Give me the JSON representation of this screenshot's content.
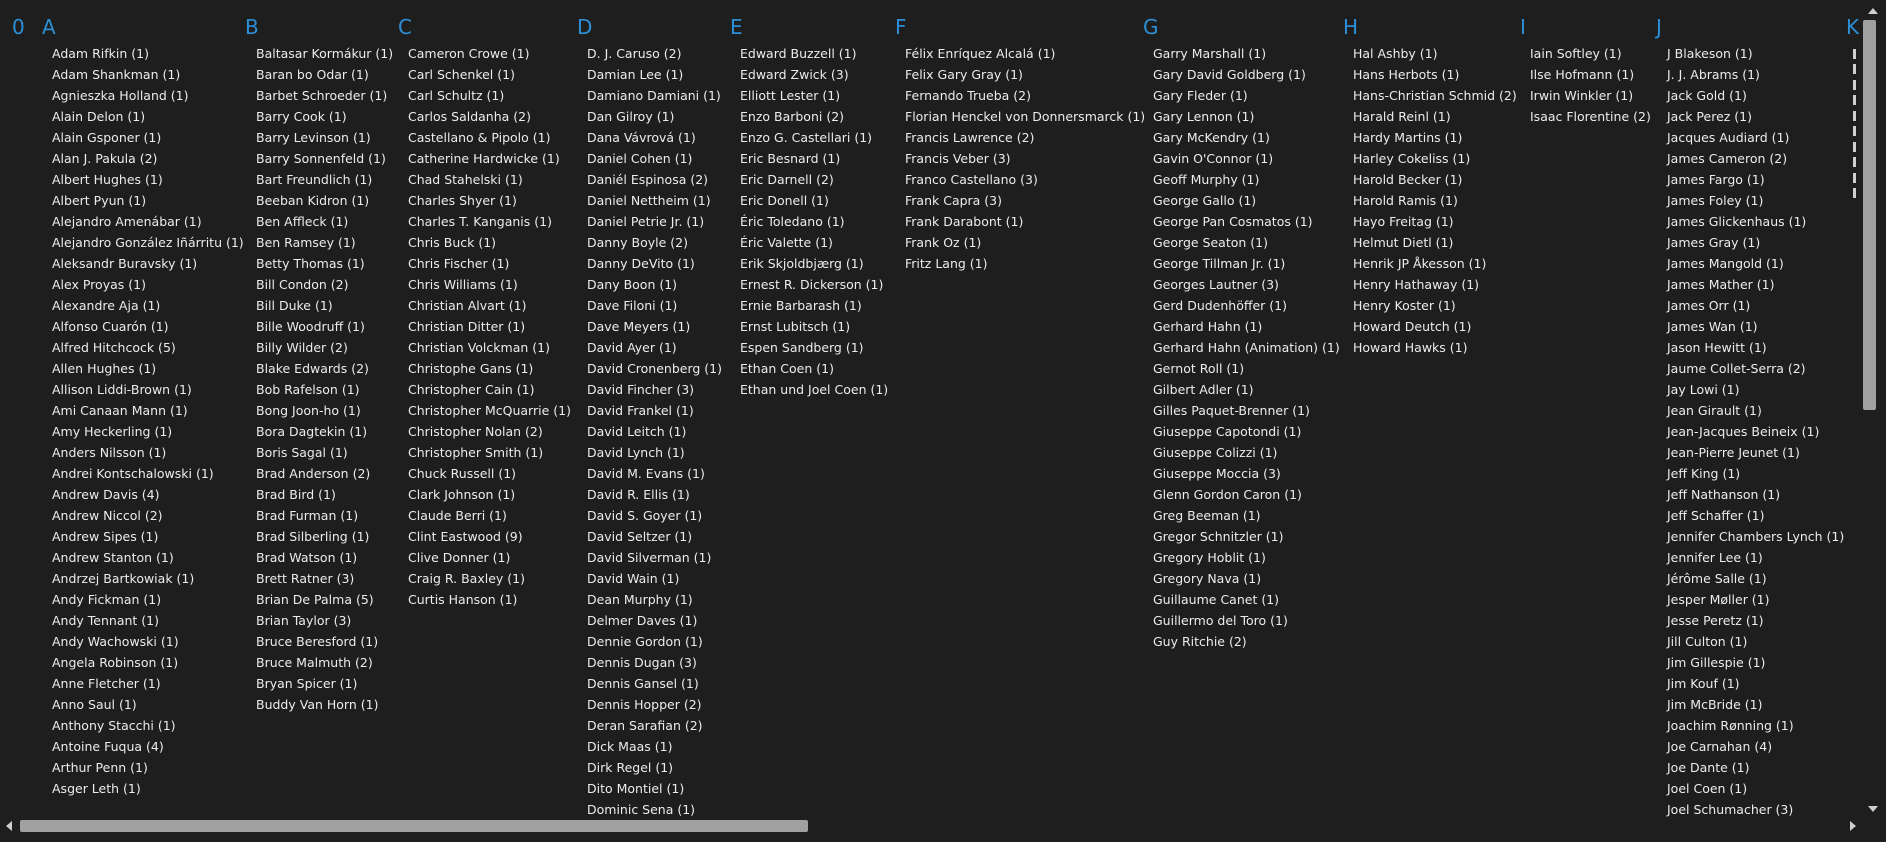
{
  "headers": {
    "h0": "0",
    "hA": "A",
    "hB": "B",
    "hC": "C",
    "hD": "D",
    "hE": "E",
    "hF": "F",
    "hG": "G",
    "hH": "H",
    "hI": "I",
    "hJ": "J",
    "hK": "K"
  },
  "theme": {
    "background": "#1e1e1e",
    "header_color": "#2d8fd5",
    "text_color": "#ececec",
    "scrollbar": "#a0a0a0"
  },
  "columns": {
    "A": [
      "Adam Rifkin (1)",
      "Adam Shankman (1)",
      "Agnieszka Holland (1)",
      "Alain Delon (1)",
      "Alain Gsponer (1)",
      "Alan J. Pakula (2)",
      "Albert Hughes (1)",
      "Albert Pyun (1)",
      "Alejandro Amenábar (1)",
      "Alejandro González Iñárritu (1)",
      "Aleksandr Buravsky (1)",
      "Alex Proyas (1)",
      "Alexandre Aja (1)",
      "Alfonso Cuarón (1)",
      "Alfred Hitchcock (5)",
      "Allen Hughes (1)",
      "Allison Liddi-Brown (1)",
      "Ami Canaan Mann (1)",
      "Amy Heckerling (1)",
      "Anders Nilsson (1)",
      "Andrei Kontschalowski (1)",
      "Andrew Davis (4)",
      "Andrew Niccol (2)",
      "Andrew Sipes (1)",
      "Andrew Stanton (1)",
      "Andrzej Bartkowiak (1)",
      "Andy Fickman (1)",
      "Andy Tennant (1)",
      "Andy Wachowski (1)",
      "Angela Robinson (1)",
      "Anne Fletcher (1)",
      "Anno Saul (1)",
      "Anthony Stacchi (1)",
      "Antoine Fuqua (4)",
      "Arthur Penn (1)",
      "Asger Leth (1)"
    ],
    "B": [
      "Baltasar Kormákur (1)",
      "Baran bo Odar (1)",
      "Barbet Schroeder (1)",
      "Barry Cook (1)",
      "Barry Levinson (1)",
      "Barry Sonnenfeld (1)",
      "Bart Freundlich (1)",
      "Beeban Kidron (1)",
      "Ben Affleck (1)",
      "Ben Ramsey (1)",
      "Betty Thomas (1)",
      "Bill Condon (2)",
      "Bill Duke (1)",
      "Bille Woodruff (1)",
      "Billy Wilder (2)",
      "Blake Edwards (2)",
      "Bob Rafelson (1)",
      "Bong Joon-ho (1)",
      "Bora Dagtekin (1)",
      "Boris Sagal (1)",
      "Brad Anderson (2)",
      "Brad Bird (1)",
      "Brad Furman (1)",
      "Brad Silberling (1)",
      "Brad Watson (1)",
      "Brett Ratner (3)",
      "Brian De Palma (5)",
      "Brian Taylor (3)",
      "Bruce Beresford (1)",
      "Bruce Malmuth (2)",
      "Bryan Spicer (1)",
      "Buddy Van Horn (1)"
    ],
    "C": [
      "Cameron Crowe (1)",
      "Carl Schenkel (1)",
      "Carl Schultz (1)",
      "Carlos Saldanha (2)",
      "Castellano & Pipolo (1)",
      "Catherine Hardwicke (1)",
      "Chad Stahelski (1)",
      "Charles Shyer (1)",
      "Charles T. Kanganis (1)",
      "Chris Buck (1)",
      "Chris Fischer (1)",
      "Chris Williams (1)",
      "Christian Alvart (1)",
      "Christian Ditter (1)",
      "Christian Volckman (1)",
      "Christophe Gans (1)",
      "Christopher Cain (1)",
      "Christopher McQuarrie (1)",
      "Christopher Nolan (2)",
      "Christopher Smith (1)",
      "Chuck Russell (1)",
      "Clark Johnson (1)",
      "Claude Berri (1)",
      "Clint Eastwood (9)",
      "Clive Donner (1)",
      "Craig R. Baxley (1)",
      "Curtis Hanson (1)"
    ],
    "D": [
      "D. J. Caruso (2)",
      "Damian Lee (1)",
      "Damiano Damiani (1)",
      "Dan Gilroy (1)",
      "Dana Vávrová (1)",
      "Daniel Cohen (1)",
      "Daniél Espinosa (2)",
      "Daniel Nettheim (1)",
      "Daniel Petrie Jr. (1)",
      "Danny Boyle (2)",
      "Danny DeVito (1)",
      "Dany Boon (1)",
      "Dave Filoni (1)",
      "Dave Meyers (1)",
      "David Ayer (1)",
      "David Cronenberg (1)",
      "David Fincher (3)",
      "David Frankel (1)",
      "David Leitch (1)",
      "David Lynch (1)",
      "David M. Evans (1)",
      "David R. Ellis (1)",
      "David S. Goyer (1)",
      "David Seltzer (1)",
      "David Silverman (1)",
      "David Wain (1)",
      "Dean Murphy (1)",
      "Delmer Daves (1)",
      "Dennie Gordon (1)",
      "Dennis Dugan (3)",
      "Dennis Gansel (1)",
      "Dennis Hopper (2)",
      "Deran Sarafian (2)",
      "Dick Maas (1)",
      "Dirk Regel (1)",
      "Dito Montiel (1)",
      "Dominic Sena (1)"
    ],
    "E": [
      "Edward Buzzell (1)",
      "Edward Zwick (3)",
      "Elliott Lester (1)",
      "Enzo Barboni (2)",
      "Enzo G. Castellari (1)",
      "Eric Besnard (1)",
      "Eric Darnell (2)",
      "Eric Donell (1)",
      "Éric Toledano (1)",
      "Éric Valette (1)",
      "Erik Skjoldbjærg (1)",
      "Ernest R. Dickerson (1)",
      "Ernie Barbarash (1)",
      "Ernst Lubitsch (1)",
      "Espen Sandberg (1)",
      "Ethan Coen (1)",
      "Ethan und Joel Coen (1)"
    ],
    "F": [
      "Félix Enríquez Alcalá (1)",
      "Felix Gary Gray (1)",
      "Fernando Trueba (2)",
      "Florian Henckel von Donnersmarck (1)",
      "Francis Lawrence (2)",
      "Francis Veber (3)",
      "Franco Castellano (3)",
      "Frank Capra (3)",
      "Frank Darabont (1)",
      "Frank Oz (1)",
      "Fritz Lang (1)"
    ],
    "G": [
      "Garry Marshall (1)",
      "Gary David Goldberg (1)",
      "Gary Fleder (1)",
      "Gary Lennon (1)",
      "Gary McKendry (1)",
      "Gavin O'Connor (1)",
      "Geoff Murphy (1)",
      "George Gallo (1)",
      "George Pan Cosmatos (1)",
      "George Seaton (1)",
      "George Tillman Jr. (1)",
      "Georges Lautner (3)",
      "Gerd Dudenhöffer (1)",
      "Gerhard Hahn (1)",
      "Gerhard Hahn (Animation) (1)",
      "Gernot Roll (1)",
      "Gilbert Adler (1)",
      "Gilles Paquet-Brenner (1)",
      "Giuseppe Capotondi (1)",
      "Giuseppe Colizzi (1)",
      "Giuseppe Moccia (3)",
      "Glenn Gordon Caron (1)",
      "Greg Beeman (1)",
      "Gregor Schnitzler (1)",
      "Gregory Hoblit (1)",
      "Gregory Nava (1)",
      "Guillaume Canet (1)",
      "Guillermo del Toro (1)",
      "Guy Ritchie (2)"
    ],
    "H": [
      "Hal Ashby (1)",
      "Hans Herbots (1)",
      "Hans-Christian Schmid (2)",
      "Harald Reinl (1)",
      "Hardy Martins (1)",
      "Harley Cokeliss (1)",
      "Harold Becker (1)",
      "Harold Ramis (1)",
      "Hayo Freitag (1)",
      "Helmut Dietl (1)",
      "Henrik JP Åkesson (1)",
      "Henry Hathaway (1)",
      "Henry Koster (1)",
      "Howard Deutch (1)",
      "Howard Hawks (1)"
    ],
    "I": [
      "Iain Softley (1)",
      "Ilse Hofmann (1)",
      "Irwin Winkler (1)",
      "Isaac Florentine (2)"
    ],
    "J": [
      "J Blakeson (1)",
      "J. J. Abrams (1)",
      "Jack Gold (1)",
      "Jack Perez (1)",
      "Jacques Audiard (1)",
      "James Cameron (2)",
      "James Fargo (1)",
      "James Foley (1)",
      "James Glickenhaus (1)",
      "James Gray (1)",
      "James Mangold (1)",
      "James Mather (1)",
      "James Orr (1)",
      "James Wan (1)",
      "Jason Hewitt (1)",
      "Jaume Collet-Serra (2)",
      "Jay Lowi (1)",
      "Jean Girault (1)",
      "Jean-Jacques Beineix (1)",
      "Jean-Pierre Jeunet (1)",
      "Jeff King (1)",
      "Jeff Nathanson (1)",
      "Jeff Schaffer (1)",
      "Jennifer Chambers Lynch (1)",
      "Jennifer Lee (1)",
      "Jérôme Salle (1)",
      "Jesper Møller (1)",
      "Jesse Peretz (1)",
      "Jill Culton (1)",
      "Jim Gillespie (1)",
      "Jim Kouf (1)",
      "Jim McBride (1)",
      "Joachim Rønning (1)",
      "Joe Carnahan (4)",
      "Joe Dante (1)",
      "Joel Coen (1)",
      "Joel Schumacher (3)"
    ]
  }
}
